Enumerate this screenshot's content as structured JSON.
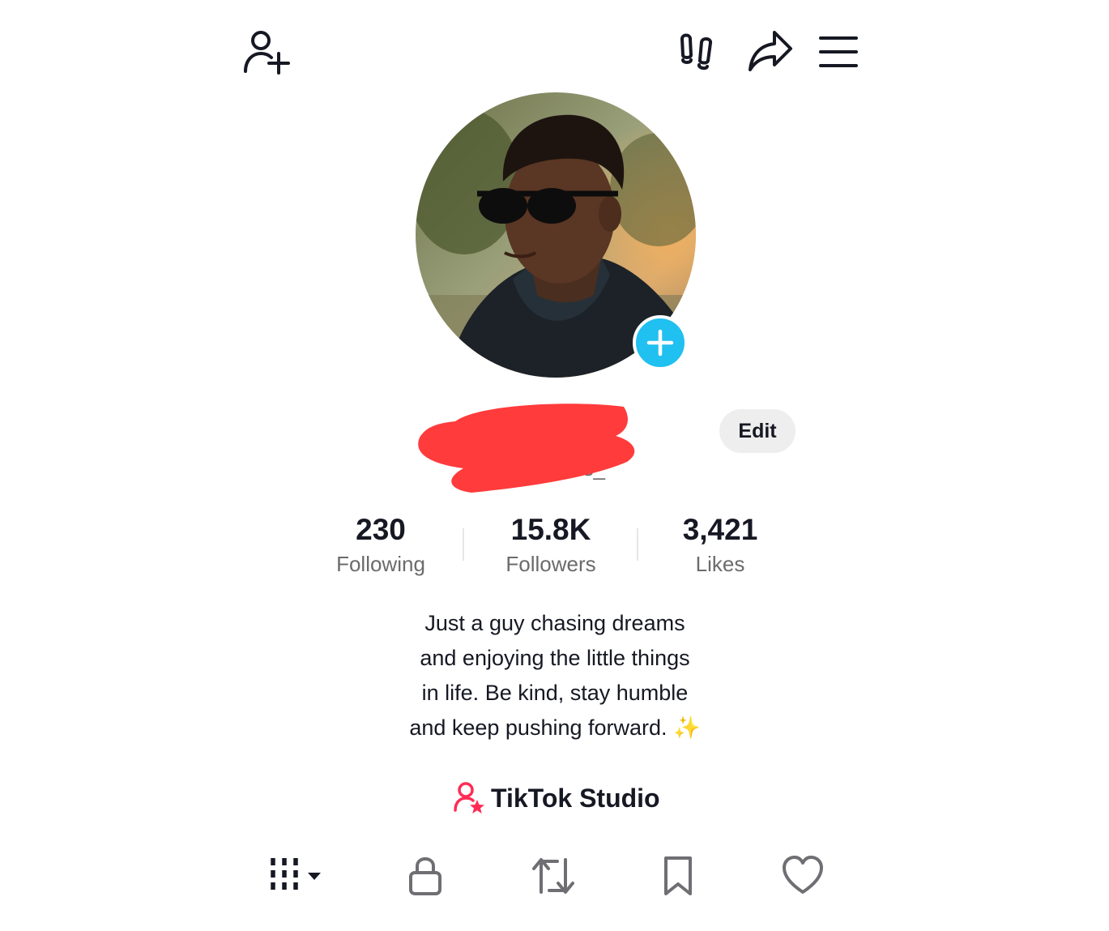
{
  "header": {
    "icons": [
      "add-friend-icon",
      "footprints-icon",
      "share-icon",
      "menu-icon"
    ]
  },
  "profile": {
    "avatar_icon": "profile-photo",
    "add_badge_icon": "plus-icon",
    "username_redacted": true,
    "handle_visible_fragment": "...oks_",
    "edit_label": "Edit"
  },
  "stats": [
    {
      "value": "230",
      "label": "Following"
    },
    {
      "value": "15.8K",
      "label": "Followers"
    },
    {
      "value": "3,421",
      "label": "Likes"
    }
  ],
  "bio": {
    "lines": [
      "Just a guy chasing dreams",
      "and enjoying the little things",
      "in life. Be kind, stay humble",
      "and keep pushing forward."
    ],
    "emoji": "✨"
  },
  "studio": {
    "label": "TikTok Studio",
    "icon": "person-star-icon",
    "color": "#fe2c55"
  },
  "tabs": [
    {
      "icon": "grid-dropdown-icon",
      "active": true
    },
    {
      "icon": "lock-icon",
      "active": false
    },
    {
      "icon": "repost-icon",
      "active": false
    },
    {
      "icon": "bookmark-icon",
      "active": false
    },
    {
      "icon": "heart-icon",
      "active": false
    }
  ],
  "colors": {
    "accent_blue": "#20c0f0",
    "redaction": "#ff3b3b",
    "text_primary": "#161823",
    "text_secondary": "#6b6b6b"
  }
}
